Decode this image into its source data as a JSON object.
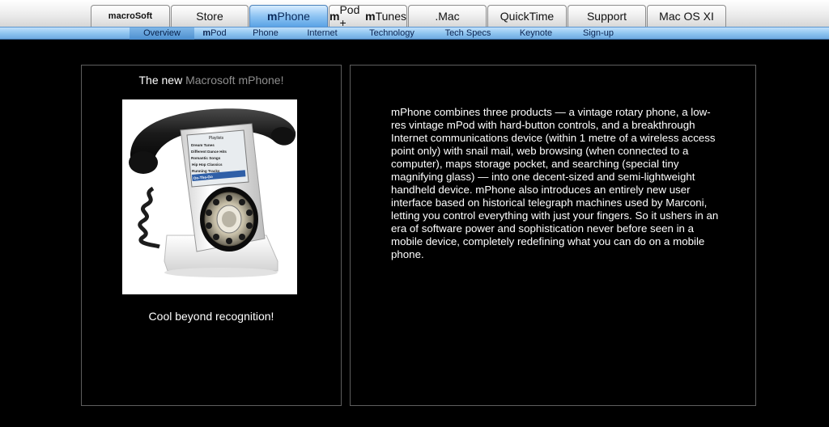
{
  "nav": {
    "tabs": [
      {
        "label": "macroSoft"
      },
      {
        "label": "Store"
      },
      {
        "prefix": "m",
        "label": "Phone"
      },
      {
        "prefix": "m",
        "label": "Pod +",
        "prefix2": "m",
        "label2": "Tunes"
      },
      {
        "label": ".Mac"
      },
      {
        "label": "QuickTime"
      },
      {
        "label": "Support"
      },
      {
        "label": "Mac OS XI"
      }
    ],
    "active_tab": "mPhone"
  },
  "subnav": {
    "items": [
      {
        "label": "Overview"
      },
      {
        "prefix": "m",
        "label": "Pod"
      },
      {
        "label": "Phone"
      },
      {
        "label": "Internet"
      },
      {
        "label": "Technology"
      },
      {
        "label": "Tech Specs"
      },
      {
        "label": "Keynote"
      },
      {
        "label": "Sign-up"
      }
    ],
    "active_item": "Overview"
  },
  "left_panel": {
    "headline_prefix": "The new ",
    "headline_product": "Macrosoft mPhone!",
    "caption": "Cool beyond recognition!",
    "image": {
      "screen_title": "Playlists",
      "screen_items": [
        "Dream Tunes",
        "Different Dance Hits",
        "Romantic Songs",
        "Hip Hop Classics",
        "Running Tracks",
        "On-The-Go"
      ]
    }
  },
  "right_panel": {
    "body": "mPhone combines three products — a vintage rotary phone, a low-res vintage mPod with hard-button controls, and a breakthrough Internet communications device (within 1 metre of a wireless access point only) with snail mail, web browsing (when connected to a computer), maps storage pocket, and searching (special tiny magnifying glass) — into one decent-sized and semi-lightweight handheld device. mPhone also introduces an entirely new user interface based on historical telegraph machines used by Marconi, letting you control everything with just your fingers. So it ushers in an era of software power and sophistication never before seen in a mobile device, completely redefining what you can do on a mobile phone."
  },
  "colors": {
    "background": "#000000",
    "active_tab": "#8fc4f3",
    "subnav": "#8cc3ef",
    "headline_grey": "#8e8e8e"
  }
}
